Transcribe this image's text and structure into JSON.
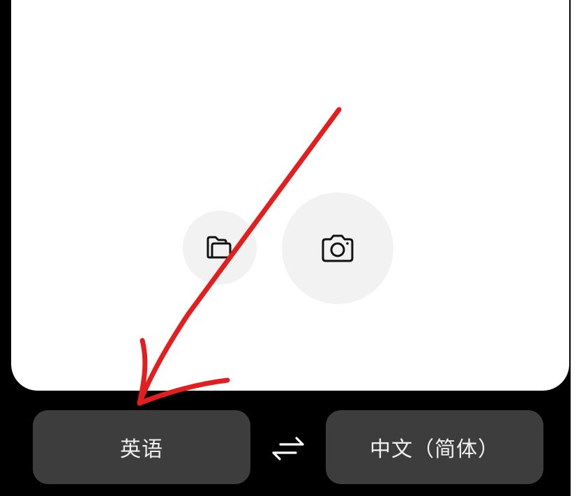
{
  "source_language": {
    "label": "英语"
  },
  "target_language": {
    "label": "中文（简体）"
  },
  "actions": {
    "folder_icon": "folder-icon",
    "camera_icon": "camera-icon",
    "swap_icon": "swap-arrows-icon"
  },
  "colors": {
    "background": "#000000",
    "card": "#ffffff",
    "round_button": "#f2f2f2",
    "language_button": "#3d3d3d",
    "annotation_arrow": "#e31e1e"
  }
}
